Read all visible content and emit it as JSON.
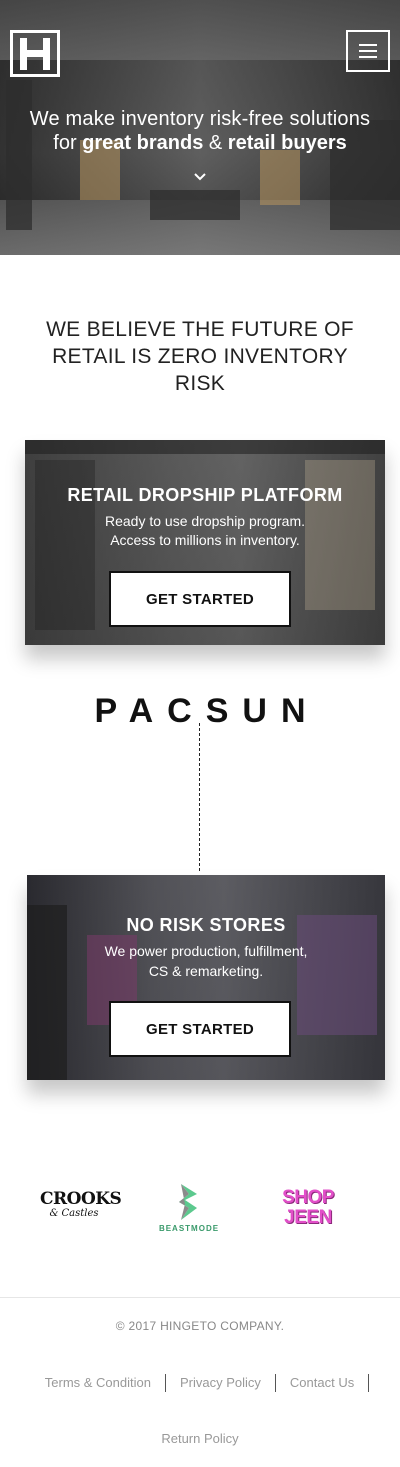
{
  "hero": {
    "line1": "We make inventory risk-free solutions",
    "line2_prefix": "for ",
    "line2_bold1": "great brands",
    "line2_mid": " & ",
    "line2_bold2": "retail buyers"
  },
  "headline": "WE BELIEVE THE FUTURE OF RETAIL IS ZERO INVENTORY RISK",
  "cards": [
    {
      "title": "RETAIL DROPSHIP PLATFORM",
      "text_line1": "Ready to use dropship program.",
      "text_line2": "Access to millions in inventory.",
      "cta": "GET STARTED"
    },
    {
      "title": "NO RISK STORES",
      "text_line1": "We power production, fulfillment,",
      "text_line2": "CS & remarketing.",
      "cta": "GET STARTED"
    }
  ],
  "partner": "PACSUN",
  "brands": {
    "crooks_top": "CROOKS",
    "crooks_bottom": "& Castles",
    "beastmode": "BEASTMODE",
    "shop_line1": "SHOP",
    "shop_line2": "JEEN"
  },
  "footer": {
    "copyright": "© 2017 HINGETO COMPANY.",
    "links": [
      "Terms & Condition",
      "Privacy Policy",
      "Contact Us"
    ],
    "return_policy": "Return Policy"
  },
  "colors": {
    "beastmode_green": "#3a9a6b",
    "shop_jeen_pink": "#e24fc9"
  }
}
